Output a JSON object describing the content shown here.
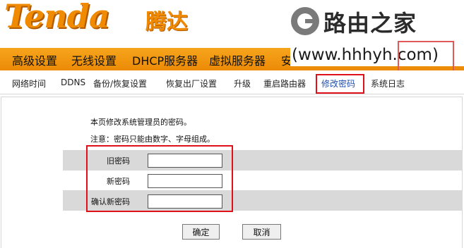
{
  "brand": {
    "logo_en": "Tenda",
    "logo_cn": "腾达"
  },
  "watermark": {
    "name": "路由之家",
    "url": "(www.hhhyh.com)"
  },
  "main_nav": {
    "items": [
      "高级设置",
      "无线设置",
      "DHCP服务器",
      "虚拟服务器",
      "安"
    ]
  },
  "sub_nav": {
    "items": [
      "网络时间",
      "DDNS",
      "备份/恢复设置",
      "恢复出厂设置",
      "升级",
      "重启路由器",
      "修改密码",
      "系统日志"
    ],
    "active": "修改密码"
  },
  "page": {
    "intro": "本页修改系统管理员的密码。",
    "note": "注意：密码只能由数字、字母组成。"
  },
  "form": {
    "old_password_label": "旧密码",
    "old_password_value": "",
    "new_password_label": "新密码",
    "new_password_value": "",
    "confirm_password_label": "确认新密码",
    "confirm_password_value": ""
  },
  "buttons": {
    "ok": "确定",
    "cancel": "取消"
  },
  "colors": {
    "brand_orange": "#f08a00",
    "nav_bar": "#ec8a06",
    "highlight_red": "#e0101a",
    "active_link": "#1f4fb0"
  }
}
